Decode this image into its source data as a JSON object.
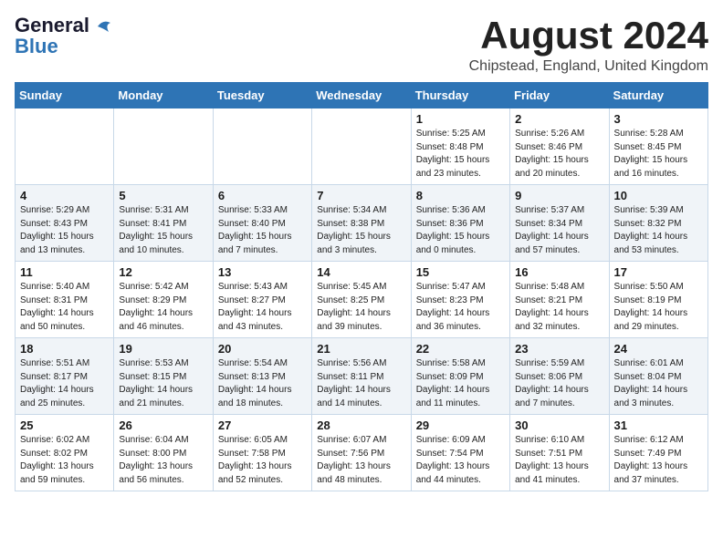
{
  "header": {
    "logo_line1": "General",
    "logo_line2": "Blue",
    "month_title": "August 2024",
    "location": "Chipstead, England, United Kingdom"
  },
  "days_of_week": [
    "Sunday",
    "Monday",
    "Tuesday",
    "Wednesday",
    "Thursday",
    "Friday",
    "Saturday"
  ],
  "weeks": [
    [
      {
        "day": "",
        "content": ""
      },
      {
        "day": "",
        "content": ""
      },
      {
        "day": "",
        "content": ""
      },
      {
        "day": "",
        "content": ""
      },
      {
        "day": "1",
        "content": "Sunrise: 5:25 AM\nSunset: 8:48 PM\nDaylight: 15 hours\nand 23 minutes."
      },
      {
        "day": "2",
        "content": "Sunrise: 5:26 AM\nSunset: 8:46 PM\nDaylight: 15 hours\nand 20 minutes."
      },
      {
        "day": "3",
        "content": "Sunrise: 5:28 AM\nSunset: 8:45 PM\nDaylight: 15 hours\nand 16 minutes."
      }
    ],
    [
      {
        "day": "4",
        "content": "Sunrise: 5:29 AM\nSunset: 8:43 PM\nDaylight: 15 hours\nand 13 minutes."
      },
      {
        "day": "5",
        "content": "Sunrise: 5:31 AM\nSunset: 8:41 PM\nDaylight: 15 hours\nand 10 minutes."
      },
      {
        "day": "6",
        "content": "Sunrise: 5:33 AM\nSunset: 8:40 PM\nDaylight: 15 hours\nand 7 minutes."
      },
      {
        "day": "7",
        "content": "Sunrise: 5:34 AM\nSunset: 8:38 PM\nDaylight: 15 hours\nand 3 minutes."
      },
      {
        "day": "8",
        "content": "Sunrise: 5:36 AM\nSunset: 8:36 PM\nDaylight: 15 hours\nand 0 minutes."
      },
      {
        "day": "9",
        "content": "Sunrise: 5:37 AM\nSunset: 8:34 PM\nDaylight: 14 hours\nand 57 minutes."
      },
      {
        "day": "10",
        "content": "Sunrise: 5:39 AM\nSunset: 8:32 PM\nDaylight: 14 hours\nand 53 minutes."
      }
    ],
    [
      {
        "day": "11",
        "content": "Sunrise: 5:40 AM\nSunset: 8:31 PM\nDaylight: 14 hours\nand 50 minutes."
      },
      {
        "day": "12",
        "content": "Sunrise: 5:42 AM\nSunset: 8:29 PM\nDaylight: 14 hours\nand 46 minutes."
      },
      {
        "day": "13",
        "content": "Sunrise: 5:43 AM\nSunset: 8:27 PM\nDaylight: 14 hours\nand 43 minutes."
      },
      {
        "day": "14",
        "content": "Sunrise: 5:45 AM\nSunset: 8:25 PM\nDaylight: 14 hours\nand 39 minutes."
      },
      {
        "day": "15",
        "content": "Sunrise: 5:47 AM\nSunset: 8:23 PM\nDaylight: 14 hours\nand 36 minutes."
      },
      {
        "day": "16",
        "content": "Sunrise: 5:48 AM\nSunset: 8:21 PM\nDaylight: 14 hours\nand 32 minutes."
      },
      {
        "day": "17",
        "content": "Sunrise: 5:50 AM\nSunset: 8:19 PM\nDaylight: 14 hours\nand 29 minutes."
      }
    ],
    [
      {
        "day": "18",
        "content": "Sunrise: 5:51 AM\nSunset: 8:17 PM\nDaylight: 14 hours\nand 25 minutes."
      },
      {
        "day": "19",
        "content": "Sunrise: 5:53 AM\nSunset: 8:15 PM\nDaylight: 14 hours\nand 21 minutes."
      },
      {
        "day": "20",
        "content": "Sunrise: 5:54 AM\nSunset: 8:13 PM\nDaylight: 14 hours\nand 18 minutes."
      },
      {
        "day": "21",
        "content": "Sunrise: 5:56 AM\nSunset: 8:11 PM\nDaylight: 14 hours\nand 14 minutes."
      },
      {
        "day": "22",
        "content": "Sunrise: 5:58 AM\nSunset: 8:09 PM\nDaylight: 14 hours\nand 11 minutes."
      },
      {
        "day": "23",
        "content": "Sunrise: 5:59 AM\nSunset: 8:06 PM\nDaylight: 14 hours\nand 7 minutes."
      },
      {
        "day": "24",
        "content": "Sunrise: 6:01 AM\nSunset: 8:04 PM\nDaylight: 14 hours\nand 3 minutes."
      }
    ],
    [
      {
        "day": "25",
        "content": "Sunrise: 6:02 AM\nSunset: 8:02 PM\nDaylight: 13 hours\nand 59 minutes."
      },
      {
        "day": "26",
        "content": "Sunrise: 6:04 AM\nSunset: 8:00 PM\nDaylight: 13 hours\nand 56 minutes."
      },
      {
        "day": "27",
        "content": "Sunrise: 6:05 AM\nSunset: 7:58 PM\nDaylight: 13 hours\nand 52 minutes."
      },
      {
        "day": "28",
        "content": "Sunrise: 6:07 AM\nSunset: 7:56 PM\nDaylight: 13 hours\nand 48 minutes."
      },
      {
        "day": "29",
        "content": "Sunrise: 6:09 AM\nSunset: 7:54 PM\nDaylight: 13 hours\nand 44 minutes."
      },
      {
        "day": "30",
        "content": "Sunrise: 6:10 AM\nSunset: 7:51 PM\nDaylight: 13 hours\nand 41 minutes."
      },
      {
        "day": "31",
        "content": "Sunrise: 6:12 AM\nSunset: 7:49 PM\nDaylight: 13 hours\nand 37 minutes."
      }
    ]
  ]
}
